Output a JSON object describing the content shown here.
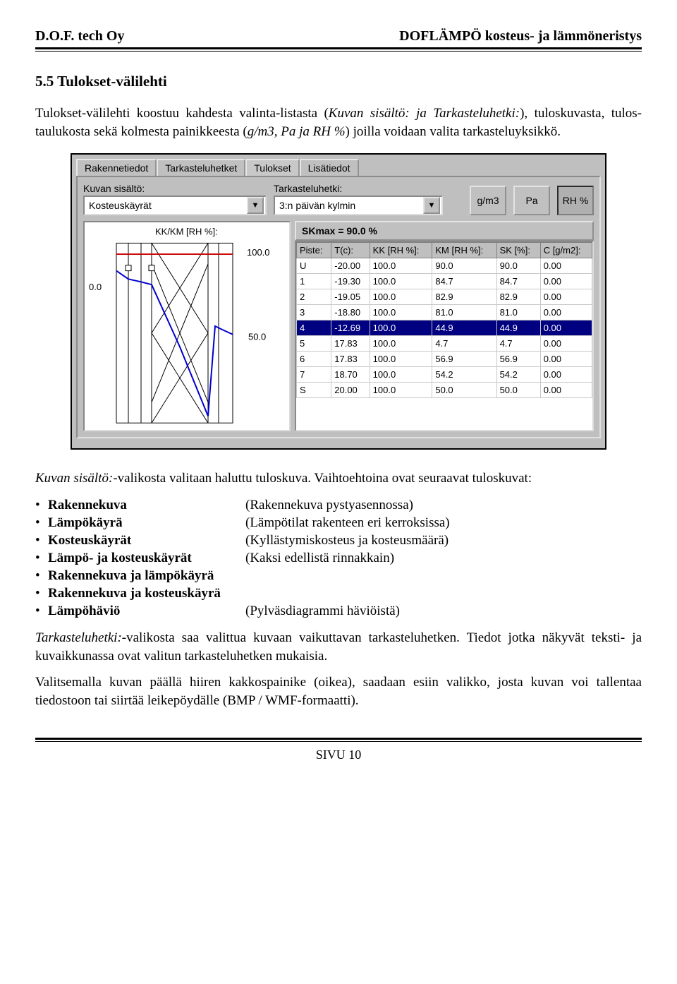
{
  "header": {
    "left": "D.O.F. tech Oy",
    "right": "DOFLÄMPÖ   kosteus- ja lämmöneristys"
  },
  "section": {
    "title": "5.5 Tulokset-välilehti",
    "intro_a": "Tulokset-välilehti koostuu kahdesta valinta-listasta (",
    "intro_i": "Kuvan sisältö: ja Tarkasteluhetki:",
    "intro_b": "), tuloskuvasta, tulos-taulukosta sekä kolmesta painikkeesta (",
    "intro_i2": "g/m3, Pa ja RH %",
    "intro_c": ") joilla voidaan valita tarkasteluyksikkö."
  },
  "ui": {
    "tabs": [
      "Rakennetiedot",
      "Tarkasteluhetket",
      "Tulokset",
      "Lisätiedot"
    ],
    "active_tab": "Tulokset",
    "dd1_label": "Kuvan sisältö:",
    "dd1_value": "Kosteuskäyrät",
    "dd2_label": "Tarkasteluhetki:",
    "dd2_value": "3:n päivän kylmin",
    "units": [
      "g/m3",
      "Pa",
      "RH %"
    ],
    "skmax": "SKmax = 90.0 %",
    "chart_title": "KK/KM [RH %]:",
    "y100": "100.0",
    "y50": "50.0",
    "xleft": "0.0",
    "cols": [
      "Piste:",
      "T(c):",
      "KK [RH %]:",
      "KM [RH %]:",
      "SK [%]:",
      "C [g/m2]:"
    ],
    "rows": [
      [
        "U",
        "-20.00",
        "100.0",
        "90.0",
        "90.0",
        "0.00"
      ],
      [
        "1",
        "-19.30",
        "100.0",
        "84.7",
        "84.7",
        "0.00"
      ],
      [
        "2",
        "-19.05",
        "100.0",
        "82.9",
        "82.9",
        "0.00"
      ],
      [
        "3",
        "-18.80",
        "100.0",
        "81.0",
        "81.0",
        "0.00"
      ],
      [
        "4",
        "-12.69",
        "100.0",
        "44.9",
        "44.9",
        "0.00"
      ],
      [
        "5",
        "17.83",
        "100.0",
        "4.7",
        "4.7",
        "0.00"
      ],
      [
        "6",
        "17.83",
        "100.0",
        "56.9",
        "56.9",
        "0.00"
      ],
      [
        "7",
        "18.70",
        "100.0",
        "54.2",
        "54.2",
        "0.00"
      ],
      [
        "S",
        "20.00",
        "100.0",
        "50.0",
        "50.0",
        "0.00"
      ]
    ],
    "selected_row": 4
  },
  "body2_a": "Kuvan sisältö:",
  "body2_b": "-valikosta valitaan haluttu tuloskuva. Vaihtoehtoina ovat seuraavat tuloskuvat:",
  "options": [
    {
      "label": "Rakennekuva",
      "desc": "(Rakennekuva pystyasennossa)"
    },
    {
      "label": "Lämpökäyrä",
      "desc": "(Lämpötilat rakenteen eri kerroksissa)"
    },
    {
      "label": "Kosteuskäyrät",
      "desc": "(Kyllästymiskosteus ja kosteusmäärä)"
    },
    {
      "label": "Lämpö- ja kosteuskäyrät",
      "desc": "(Kaksi edellistä rinnakkain)"
    },
    {
      "label": "Rakennekuva ja lämpökäyrä",
      "desc": ""
    },
    {
      "label": "Rakennekuva ja kosteuskäyrä",
      "desc": ""
    },
    {
      "label": "Lämpöhäviö",
      "desc": "(Pylväsdiagrammi häviöistä)"
    }
  ],
  "body3_a": "Tarkasteluhetki:",
  "body3_b": "-valikosta saa valittua kuvaan vaikuttavan tarkasteluhetken. Tiedot jotka näkyvät teksti- ja kuvaikkunassa ovat valitun tarkasteluhetken mukaisia.",
  "body4": "Valitsemalla kuvan päällä hiiren kakkospainike (oikea), saadaan esiin valikko, josta kuvan voi tallentaa tiedostoon tai siirtää leikepöydälle (BMP / WMF-formaatti).",
  "footer": "SIVU 10",
  "chart_data": {
    "type": "line",
    "title": "KK/KM [RH %]",
    "ylabel": "RH %",
    "ylim": [
      0,
      100
    ],
    "series": [
      {
        "name": "KK",
        "values": [
          100.0,
          100.0,
          100.0,
          100.0,
          100.0,
          100.0,
          100.0,
          100.0,
          100.0
        ]
      },
      {
        "name": "KM",
        "values": [
          90.0,
          84.7,
          82.9,
          81.0,
          44.9,
          4.7,
          56.9,
          54.2,
          50.0
        ]
      }
    ],
    "categories": [
      "U",
      "1",
      "2",
      "3",
      "4",
      "5",
      "6",
      "7",
      "S"
    ]
  }
}
